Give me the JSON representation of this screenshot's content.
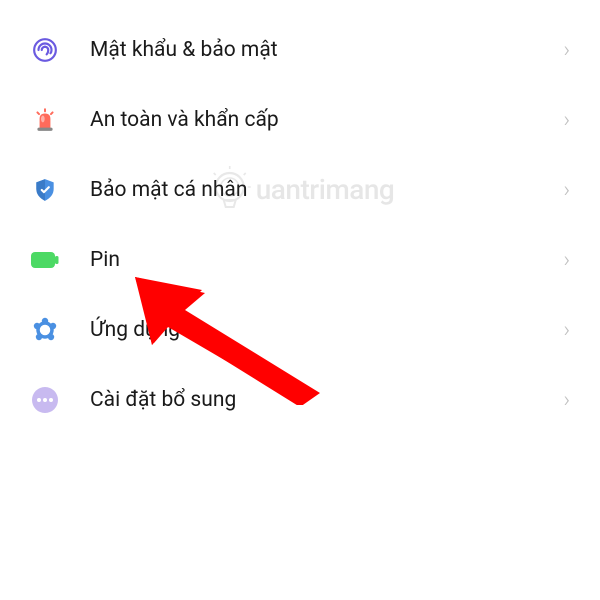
{
  "settings": {
    "items": [
      {
        "label": "Mật khẩu & bảo mật",
        "icon": "fingerprint-icon",
        "color": "#6a5ae0"
      },
      {
        "label": "An toàn và khẩn cấp",
        "icon": "siren-icon",
        "color": "#ff6b5b"
      },
      {
        "label": "Bảo mật cá nhân",
        "icon": "shield-icon",
        "color": "#4a90e2"
      },
      {
        "label": "Pin",
        "icon": "battery-icon",
        "color": "#4cd964"
      },
      {
        "label": "Ứng dụng",
        "icon": "apps-icon",
        "color": "#4a90e2"
      },
      {
        "label": "Cài đặt bổ sung",
        "icon": "more-icon",
        "color": "#b8a9e8"
      }
    ]
  },
  "watermark": {
    "text": "uantrimang"
  },
  "annotation": {
    "arrow_target_index": 3,
    "arrow_color": "#ff0000"
  }
}
